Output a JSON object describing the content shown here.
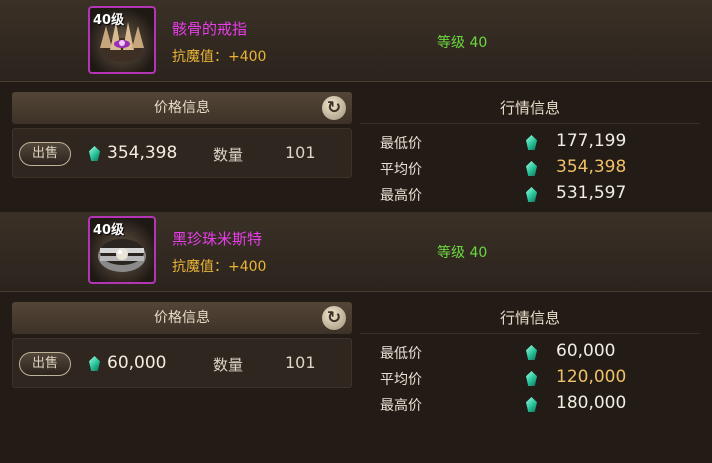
{
  "items": [
    {
      "level_badge": "40级",
      "name": "骸骨的戒指",
      "stat": "抗魔值：+400",
      "level_req": "等级 40",
      "icon": "bone-ring-icon",
      "price_header": "价格信息",
      "sell_label": "出售",
      "price": "354,398",
      "quantity_label": "数量",
      "quantity": "101",
      "market_title": "行情信息",
      "market": [
        {
          "label": "最低价",
          "value": "177,199"
        },
        {
          "label": "平均价",
          "value": "354,398"
        },
        {
          "label": "最高价",
          "value": "531,597"
        }
      ]
    },
    {
      "level_badge": "40级",
      "name": "黑珍珠米斯特",
      "stat": "抗魔值：+400",
      "level_req": "等级 40",
      "icon": "pearl-ring-icon",
      "price_header": "价格信息",
      "sell_label": "出售",
      "price": "60,000",
      "quantity_label": "数量",
      "quantity": "101",
      "market_title": "行情信息",
      "market": [
        {
          "label": "最低价",
          "value": "60,000"
        },
        {
          "label": "平均价",
          "value": "120,000"
        },
        {
          "label": "最高价",
          "value": "180,000"
        }
      ]
    }
  ],
  "icons": {
    "refresh": "refresh-icon",
    "currency": "gem-currency-icon"
  },
  "colors": {
    "item_name": "#e83ee8",
    "stat": "#e9b338",
    "level": "#6cd840",
    "average_price": "#f0c068",
    "icon_border": "#b335b5"
  }
}
